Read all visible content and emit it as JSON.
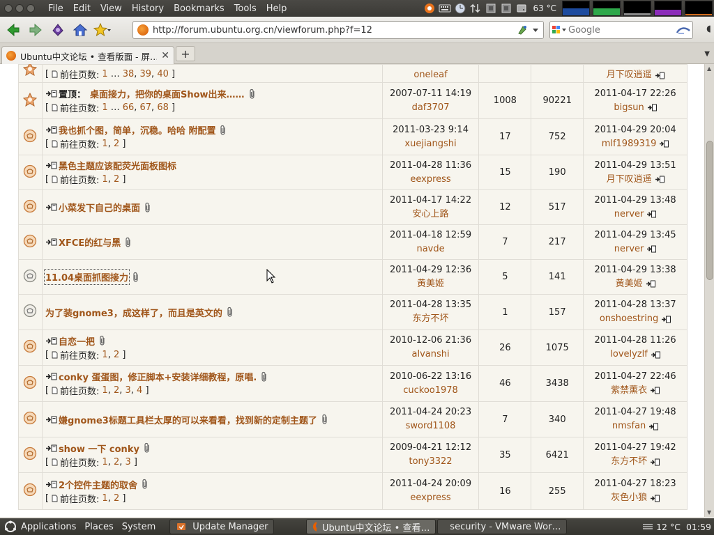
{
  "menubar": {
    "items": [
      "File",
      "Edit",
      "View",
      "History",
      "Bookmarks",
      "Tools",
      "Help"
    ],
    "temperature": "63 °C"
  },
  "nav": {
    "url": "http://forum.ubuntu.org.cn/viewforum.php?f=12",
    "search_placeholder": "Google"
  },
  "tab": {
    "title": "Ubuntu中文论坛 • 查看版面 - 屏…",
    "new_tab_label": "+"
  },
  "forum": {
    "rows": [
      {
        "icon": "sticky",
        "title": "",
        "sticky": "",
        "pages": [
          "1",
          "…",
          "38",
          "39",
          "40"
        ],
        "pages_label": "前往页数:",
        "date": "",
        "author": "oneleaf",
        "replies": "",
        "views": "",
        "last_date": "",
        "last_user": "月下叹逍遥",
        "partial_top": true
      },
      {
        "icon": "sticky",
        "title": "桌面接力，把你的桌面Show出来……",
        "sticky": "置顶：",
        "pages": [
          "1",
          "…",
          "66",
          "67",
          "68"
        ],
        "pages_label": "前往页数:",
        "date": "2007-07-11 14:19",
        "author": "daf3707",
        "replies": "1008",
        "views": "90221",
        "last_date": "2011-04-17 22:26",
        "last_user": "bigsun",
        "new": true,
        "clip": true
      },
      {
        "icon": "normal",
        "title": "我也抓个图，简单，沉稳。哈哈 附配置",
        "pages": [
          "1",
          "2"
        ],
        "pages_label": "前往页数:",
        "date": "2011-03-23 9:14",
        "author": "xuejiangshi",
        "replies": "17",
        "views": "752",
        "last_date": "2011-04-29 20:04",
        "last_user": "mlf1989319",
        "new": true,
        "clip": true
      },
      {
        "icon": "normal",
        "title": "黑色主题应该配荧光面板图标",
        "pages": [
          "1",
          "2"
        ],
        "pages_label": "前往页数:",
        "date": "2011-04-28 11:36",
        "author": "eexpress",
        "replies": "15",
        "views": "190",
        "last_date": "2011-04-29 13:51",
        "last_user": "月下叹逍遥",
        "new": true,
        "clip": false
      },
      {
        "icon": "normal",
        "title": "小菜发下自己的桌面",
        "pages": [],
        "date": "2011-04-17 14:22",
        "author": "安心上路",
        "replies": "12",
        "views": "517",
        "last_date": "2011-04-29 13:48",
        "last_user": "nerver",
        "new": true,
        "clip": true
      },
      {
        "icon": "normal",
        "title": "XFCE的红与黑",
        "pages": [],
        "date": "2011-04-18 12:59",
        "author": "navde",
        "replies": "7",
        "views": "217",
        "last_date": "2011-04-29 13:45",
        "last_user": "nerver",
        "new": true,
        "clip": true
      },
      {
        "icon": "read",
        "title": "11.04桌面抓图接力",
        "pages": [],
        "date": "2011-04-29 12:36",
        "author": "黄美姬",
        "replies": "5",
        "views": "141",
        "last_date": "2011-04-29 13:38",
        "last_user": "黄美姬",
        "new": false,
        "clip": true,
        "focused": true
      },
      {
        "icon": "read",
        "title": "为了装gnome3，成这样了，而且是英文的",
        "pages": [],
        "date": "2011-04-28 13:35",
        "author": "东方不坏",
        "replies": "1",
        "views": "157",
        "last_date": "2011-04-28 13:37",
        "last_user": "onshoestring",
        "new": false,
        "clip": true
      },
      {
        "icon": "normal",
        "title": "自恋一把",
        "pages": [
          "1",
          "2"
        ],
        "pages_label": "前往页数:",
        "date": "2010-12-06 21:36",
        "author": "alvanshi",
        "replies": "26",
        "views": "1075",
        "last_date": "2011-04-28 11:26",
        "last_user": "lovelyzlf",
        "new": true,
        "clip": true
      },
      {
        "icon": "normal",
        "title": "conky 蛋蛋图，修正脚本+安装详细教程，原唱.",
        "pages": [
          "1",
          "2",
          "3",
          "4"
        ],
        "pages_label": "前往页数:",
        "date": "2010-06-22 13:16",
        "author": "cuckoo1978",
        "replies": "46",
        "views": "3438",
        "last_date": "2011-04-27 22:46",
        "last_user": "紫禁薰衣",
        "new": true,
        "clip": true
      },
      {
        "icon": "normal",
        "title": "嫌gnome3标题工具栏太厚的可以来看看，找到新的定制主题了",
        "pages": [],
        "date": "2011-04-24 20:23",
        "author": "sword1108",
        "replies": "7",
        "views": "340",
        "last_date": "2011-04-27 19:48",
        "last_user": "nmsfan",
        "new": true,
        "clip": true
      },
      {
        "icon": "normal",
        "title": "show 一下 conky",
        "pages": [
          "1",
          "2",
          "3"
        ],
        "pages_label": "前往页数:",
        "date": "2009-04-21 12:12",
        "author": "tony3322",
        "replies": "35",
        "views": "6421",
        "last_date": "2011-04-27 19:42",
        "last_user": "东方不坏",
        "new": true,
        "clip": true
      },
      {
        "icon": "normal",
        "title": "2个控件主题的取舍",
        "pages": [
          "1",
          "2"
        ],
        "pages_label": "前往页数:",
        "date": "2011-04-24 20:09",
        "author": "eexpress",
        "replies": "16",
        "views": "255",
        "last_date": "2011-04-27 18:23",
        "last_user": "灰色小狼",
        "new": true,
        "clip": true
      }
    ]
  },
  "bottom_panel": {
    "applications": "Applications",
    "places": "Places",
    "system": "System",
    "tasks": [
      "Update Manager",
      "Ubuntu中文论坛 • 查看…",
      "security - VMware Wor…"
    ],
    "weather": "12 °C",
    "clock": "01:59"
  },
  "colors": {
    "link": "#a0561a",
    "row_bg": "#f7f5ee",
    "panel": "#3a3935"
  }
}
